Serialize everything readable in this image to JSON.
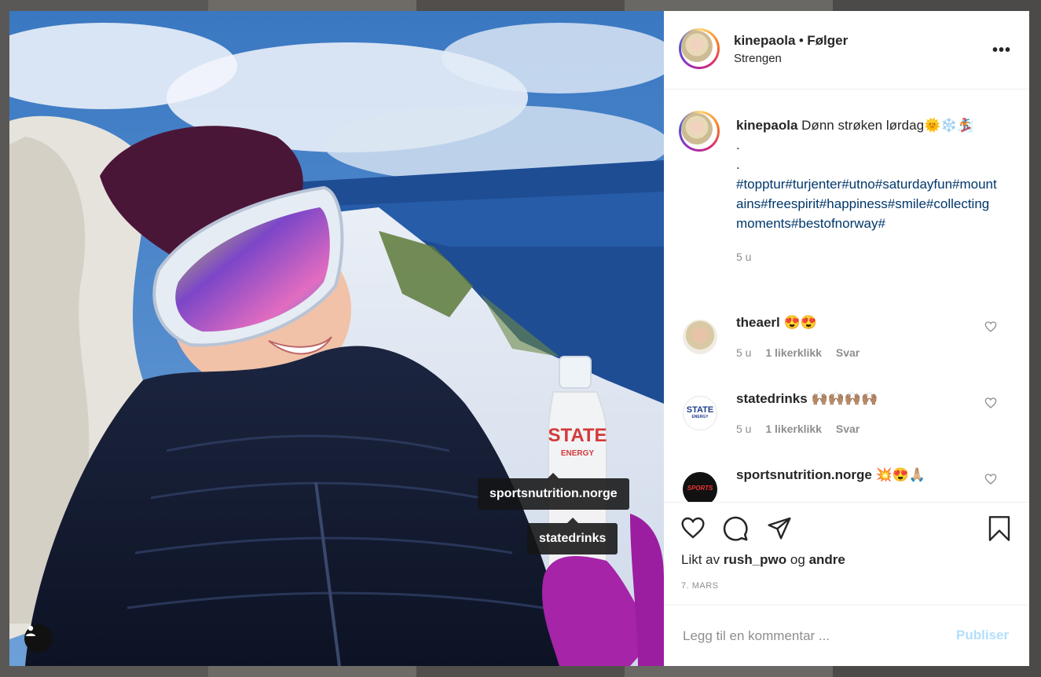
{
  "post": {
    "username": "kinepaola",
    "separator": "•",
    "follow_label": "Følger",
    "location": "Strengen",
    "more_label": "•••"
  },
  "caption": {
    "username": "kinepaola",
    "text": "Dønn strøken lørdag🌞❄️🏂",
    "dot1": ".",
    "dot2": ".",
    "hashtags": "#topptur#turjenter#utno#saturdayfun#mountains#freespirit#happiness#smile#collectingmoments#bestofnorway#",
    "time": "5 u"
  },
  "comments": [
    {
      "username": "theaerl",
      "text": "😍😍",
      "time": "5 u",
      "likes": "1 likerklikk",
      "reply": "Svar"
    },
    {
      "username": "statedrinks",
      "text": "🙌🏽🙌🏽🙌🏽🙌🏽",
      "time": "5 u",
      "likes": "1 likerklikk",
      "reply": "Svar"
    },
    {
      "username": "sportsnutrition.norge",
      "text": "💥😍🙏🏼"
    }
  ],
  "avatar_labels": {
    "statedrinks": "STATE",
    "statedrinks_sub": "ENERGY",
    "sportsnutrition": "SPORTS"
  },
  "tags": [
    "sportsnutrition.norge",
    "statedrinks"
  ],
  "bottle": {
    "brand": "STATE",
    "sub": "ENERGY"
  },
  "likes": {
    "prefix": "Likt av",
    "user": "rush_pwo",
    "mid": "og",
    "others": "andre"
  },
  "date": "7. MARS",
  "comment_input": {
    "placeholder": "Legg til en kommentar ...",
    "value": ""
  },
  "publish_label": "Publiser",
  "colors": {
    "hashtag": "#00376b",
    "publish_disabled": "#b2dffc",
    "muted": "#8e8e8e",
    "text": "#262626"
  },
  "icons": [
    "heart-icon",
    "comment-icon",
    "share-icon",
    "bookmark-icon",
    "more-icon",
    "user-tag-icon",
    "small-heart-icon"
  ]
}
